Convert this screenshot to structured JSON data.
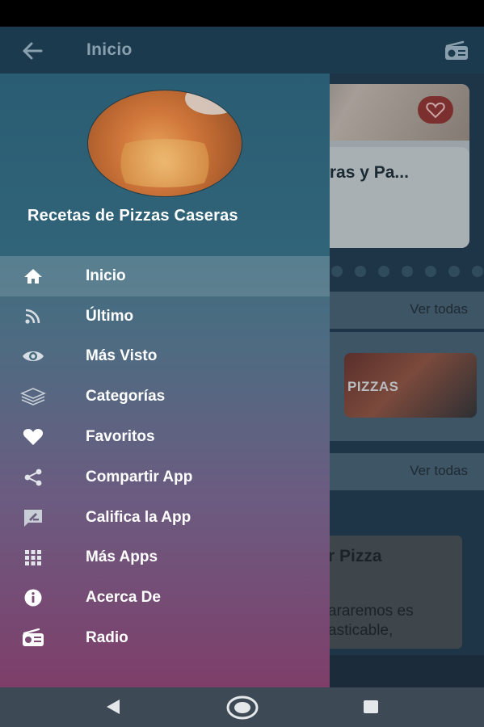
{
  "app_bar": {
    "title": "Inicio",
    "back_icon": "arrow-left-icon",
    "radio_icon": "radio-icon"
  },
  "background": {
    "slider_card_title": "arras y Pa...",
    "section1_see_all": "Ver todas",
    "category_label": "PIZZAS",
    "section2_see_all": "Ver todas",
    "recipe_title": "r Pizza",
    "recipe_text_line1": "araremos es",
    "recipe_text_line2": "asticable,"
  },
  "drawer": {
    "title": "Recetas de Pizzas Caseras",
    "items": [
      {
        "label": "Inicio",
        "icon": "home-icon",
        "active": true
      },
      {
        "label": "Último",
        "icon": "rss-icon"
      },
      {
        "label": "Más Visto",
        "icon": "eye-icon"
      },
      {
        "label": "Categorías",
        "icon": "layers-icon"
      },
      {
        "label": "Favoritos",
        "icon": "heart-icon"
      },
      {
        "label": "Compartir App",
        "icon": "share-icon"
      },
      {
        "label": "Califica la App",
        "icon": "rate-review-icon"
      },
      {
        "label": "Más Apps",
        "icon": "apps-grid-icon"
      },
      {
        "label": "Acerca De",
        "icon": "info-icon"
      },
      {
        "label": "Radio",
        "icon": "radio-icon"
      }
    ]
  },
  "nav_bar": {
    "back": "nav-back-icon",
    "home": "nav-home-icon",
    "recents": "nav-recents-icon"
  },
  "colors": {
    "drawer_top": "#2c5f74",
    "drawer_bottom": "#7e3e6a",
    "app_bar": "#1b3a4e"
  }
}
